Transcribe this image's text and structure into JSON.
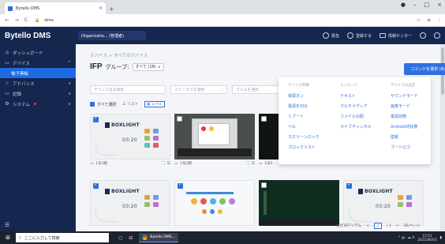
{
  "browser": {
    "tab_title": "Bytello DMS",
    "tab_close": "×",
    "new_tab": "+",
    "window_buttons": [
      "●",
      "–",
      "□",
      "×"
    ],
    "nav": {
      "back": "←",
      "forward": "→",
      "reload": "C",
      "home": "⌂"
    },
    "url": "dms",
    "addr_icons": [
      "☆",
      "≡",
      "⋮"
    ]
  },
  "app": {
    "brand": "Bytello DMS",
    "org_select": "Organizatio... (管理者)",
    "top_actions": [
      {
        "icon": "emergency-icon",
        "label": "緊急"
      },
      {
        "icon": "register-icon",
        "label": "登録する"
      },
      {
        "icon": "message-center-icon",
        "label": "情報センター"
      }
    ],
    "top_icons": [
      "gear-icon",
      "user-icon"
    ]
  },
  "sidebar": {
    "items": [
      {
        "icon": "⌂",
        "label": "ダッシュボード",
        "chevron": ""
      },
      {
        "icon": "▭",
        "label": "デバイス",
        "chevron": "^"
      },
      {
        "icon": "",
        "label": "電子黒板",
        "chevron": "",
        "active": true
      },
      {
        "icon": "☆",
        "label": "アドバンス",
        "chevron": "∨"
      },
      {
        "icon": "▭",
        "label": "記録",
        "chevron": "∨"
      },
      {
        "icon": "⚙",
        "label": "システム",
        "chevron": "∨",
        "dot": true
      }
    ],
    "collapse_icon": "☰"
  },
  "main": {
    "breadcrumb": "デバイス > すべてのデバイス",
    "title": "IFP",
    "group_label": "グループ:",
    "group_value": "すべて (18)",
    "command_button": "コマンドを選択 (8)",
    "filters": [
      {
        "placeholder": "デバイス名を検索",
        "dd": ""
      },
      {
        "placeholder": "ステータスを選択",
        "dd": "∨"
      },
      {
        "placeholder": "ラベルを選択",
        "dd": "∨"
      }
    ],
    "select_all": "すべて選択",
    "view_list": "リスト",
    "view_grid": "レベル",
    "cards": [
      {
        "type": "logo",
        "checked": true,
        "name": "1号1組",
        "brand": "BOXLIGHT",
        "time": "03:20"
      },
      {
        "type": "screen",
        "checked": false,
        "name": "1号2組"
      },
      {
        "type": "black",
        "checked": false,
        "name": "1号3"
      },
      {
        "type": "logo",
        "checked": true,
        "brand": "BOXLIGHT",
        "time": "03:20"
      },
      {
        "type": "apps",
        "checked": true
      },
      {
        "type": "desktop",
        "checked": false
      },
      {
        "type": "logo",
        "checked": true,
        "brand": "BOXLIGHT",
        "time": "03:20"
      }
    ],
    "dropdown": {
      "columns": [
        {
          "heading": "デバイス制御",
          "items": [
            "電源オン",
            "電源を切る",
            "リブート",
            "ベル",
            "スクリーンロック",
            "ブロックリスト"
          ]
        },
        {
          "heading": "メッセージ",
          "items": [
            "テキスト",
            "マルチメディア",
            "ファイルの配",
            "ライブチャンネル"
          ]
        },
        {
          "heading": "デバイスの設定",
          "items": [
            "サウンドモード",
            "画像モード",
            "電源状態",
            "Android切状態",
            "壁紙",
            "ブートロゴ"
          ]
        }
      ]
    },
    "pager": {
      "total": "合計18アイテム",
      "prev": "<",
      "current": "1",
      "of": "/ 1",
      "next": ">",
      "per_page": "20/ページ"
    }
  },
  "taskbar": {
    "search_placeholder": "ここに入力して検索",
    "app_label": "Bytello DMS...",
    "tray_text": "^ 🔈 ☁ A",
    "time": "15:51",
    "date": "2021/06/03"
  },
  "colors": {
    "navy": "#15264f",
    "accent": "#2f6fe0",
    "active_nav": "#1c6be3"
  }
}
